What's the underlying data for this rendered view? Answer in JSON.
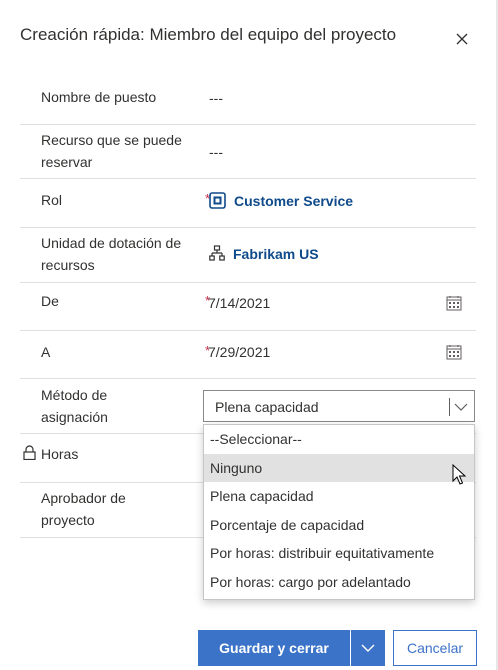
{
  "header": {
    "title": "Creación rápida: Miembro del equipo del proyecto",
    "close_icon": "close-icon"
  },
  "fields": {
    "position_name": {
      "label": "Nombre de puesto",
      "value": "---"
    },
    "bookable_resource": {
      "label": "Recurso que se puede reservar",
      "value": "---"
    },
    "role": {
      "label": "Rol",
      "required": "*",
      "value": "Customer Service",
      "icon": "role-icon"
    },
    "resourcing_unit": {
      "label": "Unidad de dotación de recursos",
      "value": "Fabrikam US",
      "icon": "org-hierarchy-icon"
    },
    "from": {
      "label": "De",
      "required": "*",
      "value": "7/14/2021",
      "icon": "calendar-icon"
    },
    "to": {
      "label": "A",
      "required": "*",
      "value": "7/29/2021",
      "icon": "calendar-icon"
    },
    "allocation_method": {
      "label": "Método de asignación",
      "value": "Plena capacidad"
    },
    "hours": {
      "label": "Horas",
      "icon": "lock-icon"
    },
    "approver": {
      "label": "Aprobador de proyecto"
    }
  },
  "dropdown": {
    "options": [
      "--Seleccionar--",
      "Ninguno",
      "Plena capacidad",
      "Porcentaje de capacidad",
      "Por horas: distribuir equitativamente",
      "Por horas: cargo por adelantado"
    ],
    "hovered": "Ninguno"
  },
  "footer": {
    "save_label": "Guardar y cerrar",
    "cancel_label": "Cancelar"
  },
  "colors": {
    "primary": "#3b73c8",
    "link": "#0f4a8a",
    "required": "#c4314b"
  }
}
